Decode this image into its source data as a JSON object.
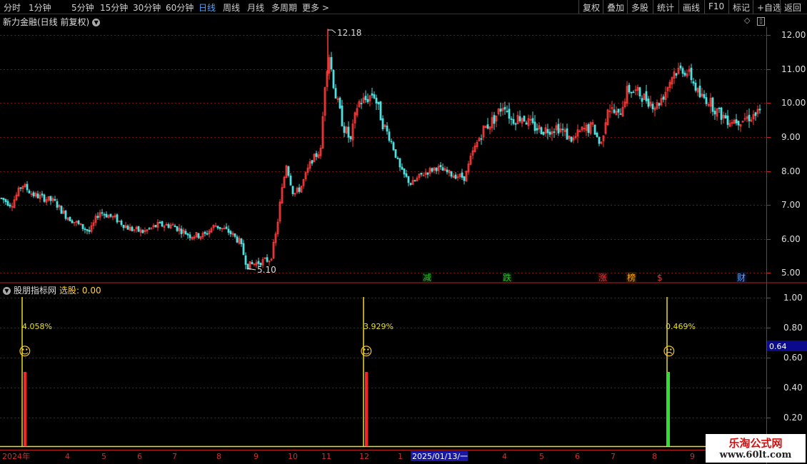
{
  "toolbar": {
    "periods": [
      "分时",
      "1分钟",
      "5分钟",
      "15分钟",
      "30分钟",
      "60分钟",
      "日线",
      "周线",
      "月线",
      "多周期",
      "更多 >"
    ],
    "active_period": "日线",
    "right_buttons": [
      "复权",
      "叠加",
      "多股",
      "统计",
      "画线",
      "F10",
      "标记",
      "+自选",
      "返回"
    ]
  },
  "main_chart": {
    "title": "新力金融(日线 前复权)",
    "price_axis": [
      "12.00",
      "11.00",
      "10.00",
      "9.00",
      "8.00",
      "7.00",
      "6.00",
      "5.00"
    ],
    "high_label": "12.18",
    "low_label": "5.10",
    "event_markers": [
      {
        "text": "减",
        "color": "#22cc22"
      },
      {
        "text": "跌",
        "color": "#22cc22"
      },
      {
        "text": "涨",
        "color": "#ff3030"
      },
      {
        "text": "榜",
        "color": "#ffaa00"
      },
      {
        "text": "$",
        "color": "#ff3030"
      },
      {
        "text": "财",
        "color": "#5aa0ff"
      }
    ]
  },
  "indicator": {
    "name": "股朋指标网",
    "select_label": "选股: 0.00",
    "axis": [
      "1.00",
      "0.80",
      "0.60",
      "0.40",
      "0.20"
    ],
    "cursor_value": "0.64",
    "signals": [
      {
        "pct": "4.058%",
        "face": "☺",
        "bar_color": "#ff2020"
      },
      {
        "pct": "3.929%",
        "face": "☺",
        "bar_color": "#ff2020"
      },
      {
        "pct": "0.469%",
        "face": "☹",
        "bar_color": "#33dd33"
      }
    ]
  },
  "time_axis": {
    "labels": [
      "2024年",
      "4",
      "5",
      "6",
      "7",
      "8",
      "9",
      "10",
      "11",
      "12",
      "1",
      "4",
      "5",
      "6",
      "7",
      "8",
      "9"
    ],
    "cursor_date": "2025/01/13/一"
  },
  "watermark": {
    "line1": "乐淘公式网",
    "line2": "www.60lt.com"
  },
  "colors": {
    "up": "#ff3a3a",
    "down": "#4fe0e0",
    "grid": "#8a1a1a",
    "axis": "#cc2020"
  }
}
